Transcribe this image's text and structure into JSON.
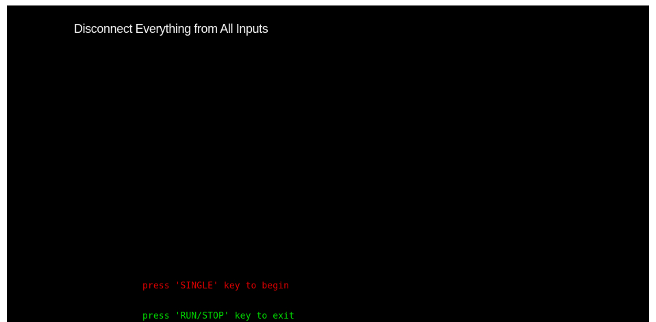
{
  "screen": {
    "background_color": "#000000",
    "title": "Disconnect Everything from All Inputs",
    "title_color": "#f0f0f0"
  },
  "prompts": {
    "begin": "press 'SINGLE' key to begin",
    "begin_color": "#e00000",
    "exit": "press 'RUN/STOP' key to exit",
    "exit_color": "#00d800"
  }
}
